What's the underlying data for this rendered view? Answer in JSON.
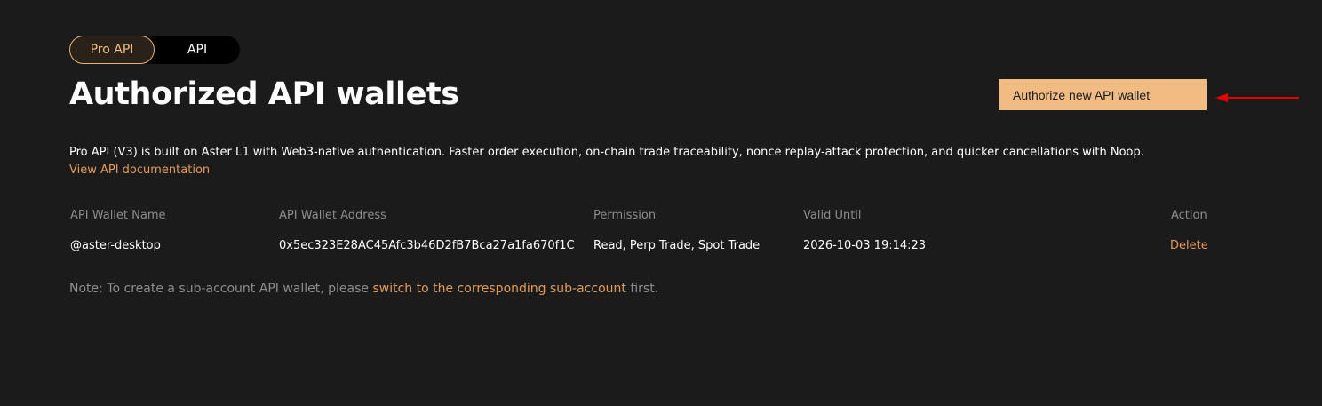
{
  "tabs": [
    {
      "label": "Pro API",
      "active": true
    },
    {
      "label": "API",
      "active": false
    }
  ],
  "title": "Authorized API wallets",
  "authorize_button": "Authorize new API wallet",
  "description": {
    "text_before": "Pro API (V3) is built on Aster ",
    "l1": "L1",
    "text_after": " with Web3-native authentication. Faster order execution, on-chain trade traceability, nonce replay-attack protection, and quicker cancellations with Noop. ",
    "link": "View API documentation"
  },
  "table": {
    "headers": [
      "API Wallet Name",
      "API Wallet Address",
      "Permission",
      "Valid Until",
      "Action"
    ],
    "rows": [
      {
        "name": "@aster-desktop",
        "address": "0x5ec323E28AC45Afc3b46D2fB7Bca27a1fa670f1C",
        "permission": "Read, Perp Trade, Spot Trade",
        "valid_until": "2026-10-03 19:14:23",
        "action": "Delete"
      }
    ]
  },
  "note": {
    "before": "Note: To create a sub-account API wallet, please ",
    "link": "switch to the corresponding sub-account",
    "after": " first."
  },
  "colors": {
    "accent": "#f0bc84",
    "link": "#e39b5a",
    "background": "#1b1b1b",
    "muted_text": "#8d8d8d",
    "annotation_arrow": "#e00000"
  }
}
